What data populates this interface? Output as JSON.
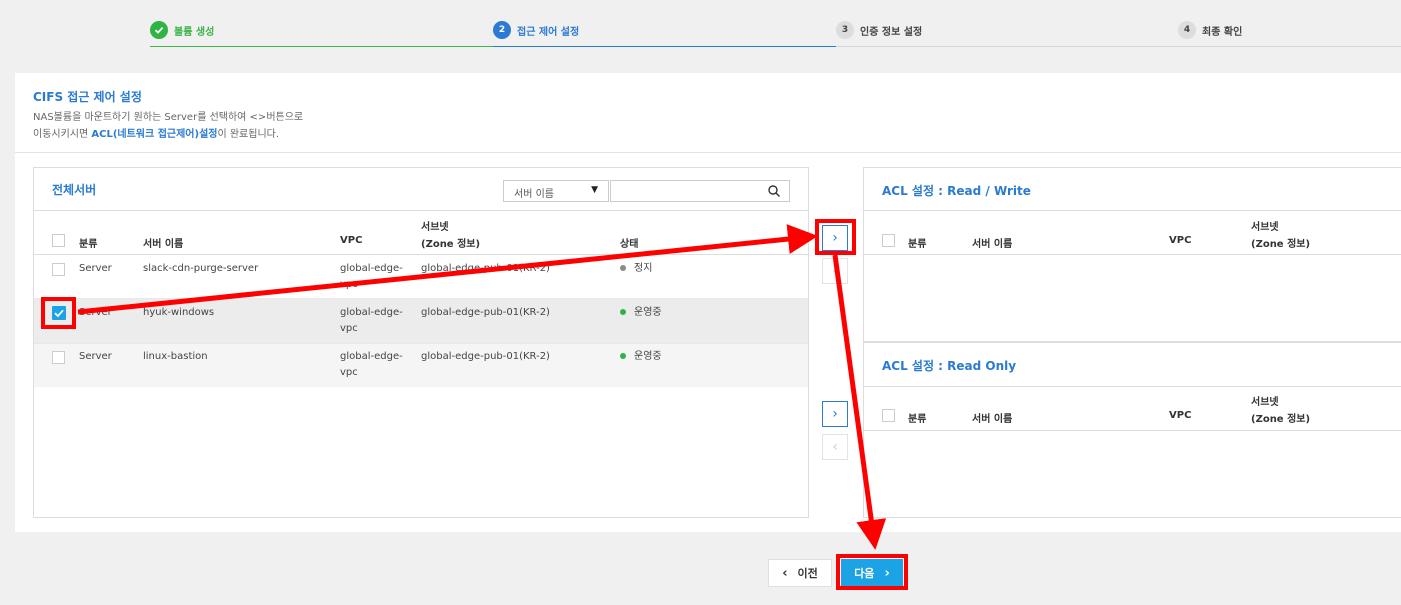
{
  "steps": [
    {
      "num": "✓",
      "label": "볼륨 생성",
      "state": "done"
    },
    {
      "num": "2",
      "label": "접근 제어 설정",
      "state": "active"
    },
    {
      "num": "3",
      "label": "인증 정보 설정",
      "state": "todo"
    },
    {
      "num": "4",
      "label": "최종 확인",
      "state": "todo"
    }
  ],
  "section": {
    "title": "CIFS 접근 제어 설정",
    "desc_line1": "NAS볼륨을 마운트하기 원하는 Server를 선택하여 <>버튼으로",
    "desc_line2_prefix": "이동시키시면 ",
    "desc_line2_bold": "ACL(네트워크 접근제어)설정",
    "desc_line2_suffix": "이 완료됩니다."
  },
  "all_servers": {
    "title": "전체서버",
    "search_select": "서버 이름",
    "search_value": "",
    "columns": {
      "type": "분류",
      "name": "서버 이름",
      "vpc": "VPC",
      "subnet1": "서브넷",
      "subnet2": "(Zone 정보)",
      "status": "상태"
    },
    "rows": [
      {
        "type": "Server",
        "name": "slack-cdn-purge-server",
        "vpc1": "global-edge-",
        "vpc2": "vpc",
        "subnet": "global-edge-pub-01(KR-2)",
        "status": "정지",
        "status_color": "#8a8a8a",
        "checked": false
      },
      {
        "type": "Server",
        "name": "hyuk-windows",
        "vpc1": "global-edge-",
        "vpc2": "vpc",
        "subnet": "global-edge-pub-01(KR-2)",
        "status": "운영중",
        "status_color": "#2fb344",
        "checked": true
      },
      {
        "type": "Server",
        "name": "linux-bastion",
        "vpc1": "global-edge-",
        "vpc2": "vpc",
        "subnet": "global-edge-pub-01(KR-2)",
        "status": "운영중",
        "status_color": "#2fb344",
        "checked": false
      }
    ]
  },
  "acl_rw": {
    "title": "ACL 설정 : Read / Write",
    "columns": {
      "type": "분류",
      "name": "서버 이름",
      "vpc": "VPC",
      "subnet1": "서브넷",
      "subnet2": "(Zone 정보)"
    }
  },
  "acl_ro": {
    "title": "ACL 설정 : Read Only",
    "columns": {
      "type": "분류",
      "name": "서버 이름",
      "vpc": "VPC",
      "subnet1": "서브넷",
      "subnet2": "(Zone 정보)"
    }
  },
  "buttons": {
    "prev": "이전",
    "next": "다음"
  },
  "colors": {
    "accent": "#2a7bd1",
    "next_button": "#1ba3e6",
    "annotation": "#ff0000",
    "done": "#2fb344"
  }
}
